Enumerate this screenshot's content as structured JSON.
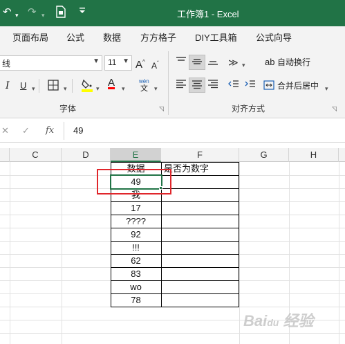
{
  "colors": {
    "excel_green": "#217346",
    "highlight_red": "#e0262b",
    "fill_yellow": "#ffff00",
    "font_red": "#ff0000"
  },
  "titlebar": {
    "title": "工作簿1 - Excel"
  },
  "tabs": [
    "页面布局",
    "公式",
    "数据",
    "方方格子",
    "DIY工具箱",
    "公式向导"
  ],
  "ribbon": {
    "font_name": "线",
    "font_size": "11",
    "wrap_text": "自动换行",
    "merge_center": "合并后居中",
    "group_font": "字体",
    "group_align": "对齐方式",
    "italic": "I",
    "underline": "U",
    "font_color_letter": "A",
    "grow_font": "A",
    "shrink_font": "A",
    "wen": "wén"
  },
  "formula_bar": {
    "value": "49"
  },
  "columns": [
    "C",
    "D",
    "E",
    "F",
    "G",
    "H"
  ],
  "active_column": "E",
  "table": {
    "header_e": "数据",
    "header_f": "是否为数字",
    "values": [
      "49",
      "我",
      "17",
      "????",
      "92",
      "!!!",
      "62",
      "83",
      "wo",
      "78"
    ]
  }
}
